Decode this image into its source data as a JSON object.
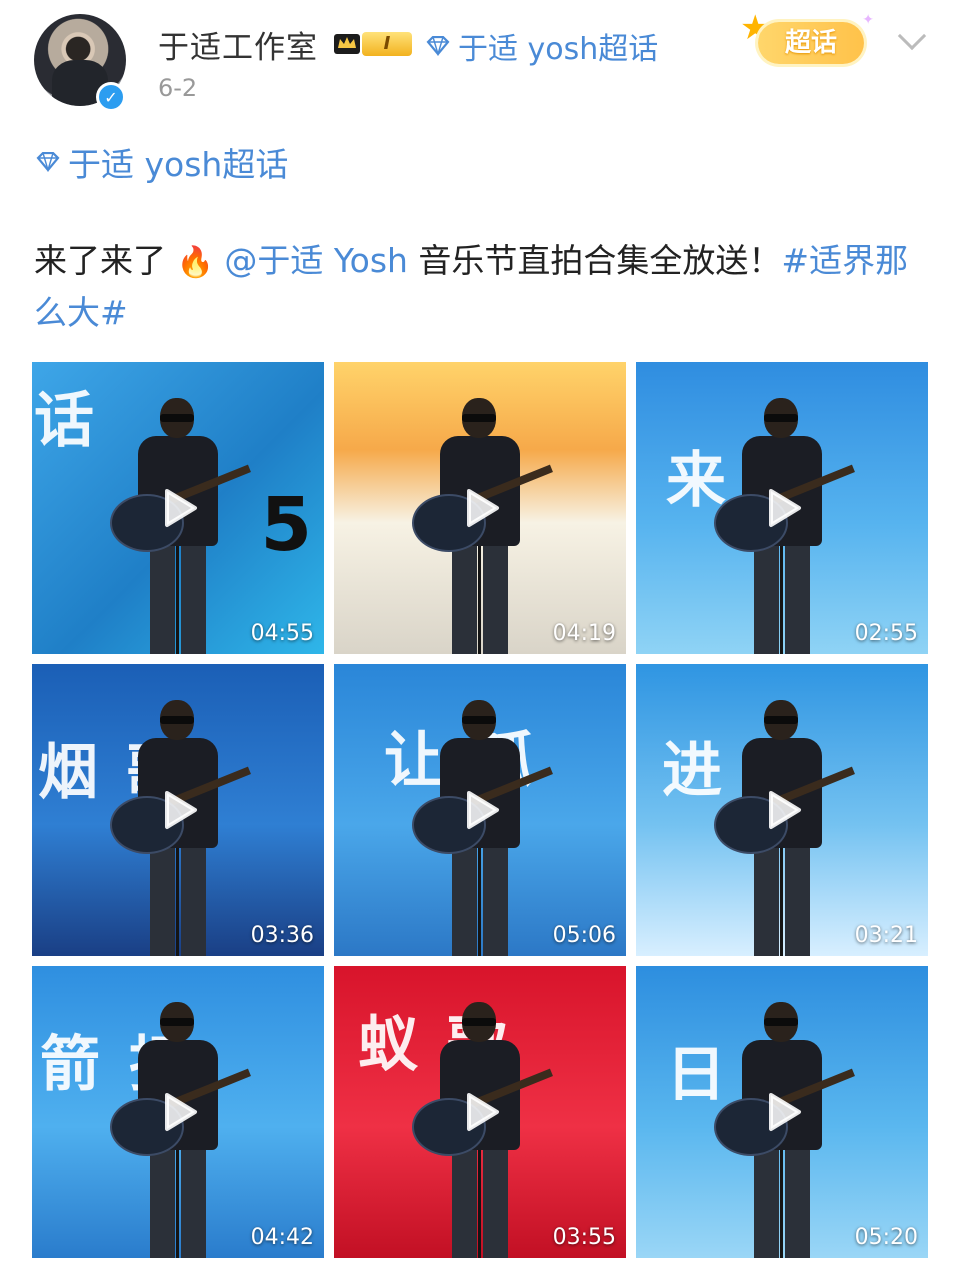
{
  "post": {
    "author": "于适工作室",
    "level_badge": "I",
    "header_topic": "于适 yosh超话",
    "date": "6-2",
    "super_topic_badge": "超话",
    "topic_line": "于适 yosh超话",
    "text_prefix": "来了来了",
    "mention": "@于适 Yosh",
    "text_main": " 音乐节直拍合集全放送！",
    "hashtag": "#适界那么大#"
  },
  "colors": {
    "link": "#4a8ad6",
    "verified": "#2c9df0",
    "level_gold": "#f2b21f"
  },
  "icons": {
    "verified": "verified-icon",
    "crown": "crown-icon",
    "diamond": "diamond-icon",
    "fire": "fire-emoji",
    "chevron": "chevron-down-icon",
    "play": "play-icon"
  },
  "videos": [
    {
      "duration": "04:55",
      "overlay_text": "话",
      "overlay_text2": "5"
    },
    {
      "duration": "04:19",
      "overlay_text": "",
      "overlay_text2": ""
    },
    {
      "duration": "02:55",
      "overlay_text": "来 这",
      "overlay_text2": ""
    },
    {
      "duration": "03:36",
      "overlay_text": "烟 歌",
      "overlay_text2": ""
    },
    {
      "duration": "05:06",
      "overlay_text": "让 孤",
      "overlay_text2": ""
    },
    {
      "duration": "03:21",
      "overlay_text": "进 》",
      "overlay_text2": ""
    },
    {
      "duration": "04:42",
      "overlay_text": "箭 择",
      "overlay_text2": ""
    },
    {
      "duration": "03:55",
      "overlay_text": "蚁 歌",
      "overlay_text2": ""
    },
    {
      "duration": "05:20",
      "overlay_text": "日 途",
      "overlay_text2": ""
    }
  ]
}
